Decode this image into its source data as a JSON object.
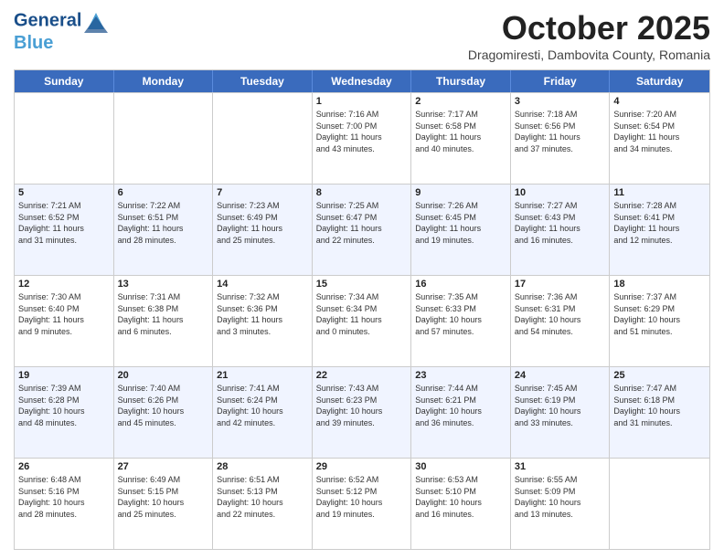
{
  "header": {
    "logo_line1": "General",
    "logo_line2": "Blue",
    "month": "October 2025",
    "location": "Dragomiresti, Dambovita County, Romania"
  },
  "days_of_week": [
    "Sunday",
    "Monday",
    "Tuesday",
    "Wednesday",
    "Thursday",
    "Friday",
    "Saturday"
  ],
  "weeks": [
    [
      {
        "day": "",
        "info": ""
      },
      {
        "day": "",
        "info": ""
      },
      {
        "day": "",
        "info": ""
      },
      {
        "day": "1",
        "info": "Sunrise: 7:16 AM\nSunset: 7:00 PM\nDaylight: 11 hours\nand 43 minutes."
      },
      {
        "day": "2",
        "info": "Sunrise: 7:17 AM\nSunset: 6:58 PM\nDaylight: 11 hours\nand 40 minutes."
      },
      {
        "day": "3",
        "info": "Sunrise: 7:18 AM\nSunset: 6:56 PM\nDaylight: 11 hours\nand 37 minutes."
      },
      {
        "day": "4",
        "info": "Sunrise: 7:20 AM\nSunset: 6:54 PM\nDaylight: 11 hours\nand 34 minutes."
      }
    ],
    [
      {
        "day": "5",
        "info": "Sunrise: 7:21 AM\nSunset: 6:52 PM\nDaylight: 11 hours\nand 31 minutes."
      },
      {
        "day": "6",
        "info": "Sunrise: 7:22 AM\nSunset: 6:51 PM\nDaylight: 11 hours\nand 28 minutes."
      },
      {
        "day": "7",
        "info": "Sunrise: 7:23 AM\nSunset: 6:49 PM\nDaylight: 11 hours\nand 25 minutes."
      },
      {
        "day": "8",
        "info": "Sunrise: 7:25 AM\nSunset: 6:47 PM\nDaylight: 11 hours\nand 22 minutes."
      },
      {
        "day": "9",
        "info": "Sunrise: 7:26 AM\nSunset: 6:45 PM\nDaylight: 11 hours\nand 19 minutes."
      },
      {
        "day": "10",
        "info": "Sunrise: 7:27 AM\nSunset: 6:43 PM\nDaylight: 11 hours\nand 16 minutes."
      },
      {
        "day": "11",
        "info": "Sunrise: 7:28 AM\nSunset: 6:41 PM\nDaylight: 11 hours\nand 12 minutes."
      }
    ],
    [
      {
        "day": "12",
        "info": "Sunrise: 7:30 AM\nSunset: 6:40 PM\nDaylight: 11 hours\nand 9 minutes."
      },
      {
        "day": "13",
        "info": "Sunrise: 7:31 AM\nSunset: 6:38 PM\nDaylight: 11 hours\nand 6 minutes."
      },
      {
        "day": "14",
        "info": "Sunrise: 7:32 AM\nSunset: 6:36 PM\nDaylight: 11 hours\nand 3 minutes."
      },
      {
        "day": "15",
        "info": "Sunrise: 7:34 AM\nSunset: 6:34 PM\nDaylight: 11 hours\nand 0 minutes."
      },
      {
        "day": "16",
        "info": "Sunrise: 7:35 AM\nSunset: 6:33 PM\nDaylight: 10 hours\nand 57 minutes."
      },
      {
        "day": "17",
        "info": "Sunrise: 7:36 AM\nSunset: 6:31 PM\nDaylight: 10 hours\nand 54 minutes."
      },
      {
        "day": "18",
        "info": "Sunrise: 7:37 AM\nSunset: 6:29 PM\nDaylight: 10 hours\nand 51 minutes."
      }
    ],
    [
      {
        "day": "19",
        "info": "Sunrise: 7:39 AM\nSunset: 6:28 PM\nDaylight: 10 hours\nand 48 minutes."
      },
      {
        "day": "20",
        "info": "Sunrise: 7:40 AM\nSunset: 6:26 PM\nDaylight: 10 hours\nand 45 minutes."
      },
      {
        "day": "21",
        "info": "Sunrise: 7:41 AM\nSunset: 6:24 PM\nDaylight: 10 hours\nand 42 minutes."
      },
      {
        "day": "22",
        "info": "Sunrise: 7:43 AM\nSunset: 6:23 PM\nDaylight: 10 hours\nand 39 minutes."
      },
      {
        "day": "23",
        "info": "Sunrise: 7:44 AM\nSunset: 6:21 PM\nDaylight: 10 hours\nand 36 minutes."
      },
      {
        "day": "24",
        "info": "Sunrise: 7:45 AM\nSunset: 6:19 PM\nDaylight: 10 hours\nand 33 minutes."
      },
      {
        "day": "25",
        "info": "Sunrise: 7:47 AM\nSunset: 6:18 PM\nDaylight: 10 hours\nand 31 minutes."
      }
    ],
    [
      {
        "day": "26",
        "info": "Sunrise: 6:48 AM\nSunset: 5:16 PM\nDaylight: 10 hours\nand 28 minutes."
      },
      {
        "day": "27",
        "info": "Sunrise: 6:49 AM\nSunset: 5:15 PM\nDaylight: 10 hours\nand 25 minutes."
      },
      {
        "day": "28",
        "info": "Sunrise: 6:51 AM\nSunset: 5:13 PM\nDaylight: 10 hours\nand 22 minutes."
      },
      {
        "day": "29",
        "info": "Sunrise: 6:52 AM\nSunset: 5:12 PM\nDaylight: 10 hours\nand 19 minutes."
      },
      {
        "day": "30",
        "info": "Sunrise: 6:53 AM\nSunset: 5:10 PM\nDaylight: 10 hours\nand 16 minutes."
      },
      {
        "day": "31",
        "info": "Sunrise: 6:55 AM\nSunset: 5:09 PM\nDaylight: 10 hours\nand 13 minutes."
      },
      {
        "day": "",
        "info": ""
      }
    ]
  ]
}
